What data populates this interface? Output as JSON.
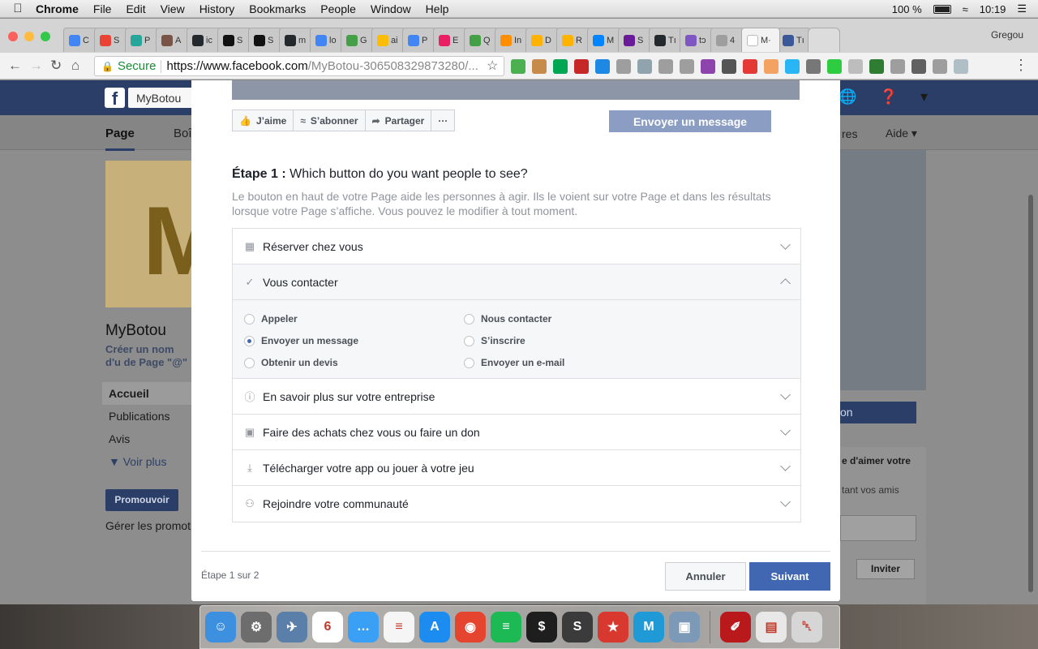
{
  "mac_menu": {
    "app": "Chrome",
    "items": [
      "File",
      "Edit",
      "View",
      "History",
      "Bookmarks",
      "People",
      "Window",
      "Help"
    ],
    "battery": "100 %",
    "time": "10:19"
  },
  "browser": {
    "profile": "Gregou",
    "tabs": [
      {
        "label": "C",
        "color": "#4285f4"
      },
      {
        "label": "S",
        "color": "#ea4335"
      },
      {
        "label": "P",
        "color": "#26a69a"
      },
      {
        "label": "A",
        "color": "#795548"
      },
      {
        "label": "ic",
        "color": "#24292e"
      },
      {
        "label": "S",
        "color": "#111111"
      },
      {
        "label": "S",
        "color": "#111111"
      },
      {
        "label": "m",
        "color": "#24292e"
      },
      {
        "label": "lo",
        "color": "#4285f4"
      },
      {
        "label": "G",
        "color": "#43a047"
      },
      {
        "label": "ai",
        "color": "#fbbc05"
      },
      {
        "label": "P",
        "color": "#4285f4"
      },
      {
        "label": "E",
        "color": "#e91e63"
      },
      {
        "label": "Q",
        "color": "#43a047"
      },
      {
        "label": "In",
        "color": "#ff8f00"
      },
      {
        "label": "D",
        "color": "#ffb300"
      },
      {
        "label": "R",
        "color": "#ffb300"
      },
      {
        "label": "M",
        "color": "#0084ff"
      },
      {
        "label": "S",
        "color": "#6a1b9a"
      },
      {
        "label": "Tı",
        "color": "#24292e"
      },
      {
        "label": "tɔ",
        "color": "#7e57c2"
      },
      {
        "label": "4",
        "color": "#9e9e9e"
      },
      {
        "label": "M·",
        "color": "#ffffff",
        "active": true
      },
      {
        "label": "Tı",
        "color": "#3b5998"
      }
    ],
    "secure_label": "Secure",
    "url_host": "https://www.facebook.com",
    "url_rest": "/MyBotou-306508329873280/...",
    "extensions": [
      "#4caf50",
      "#c68a4b",
      "#00a651",
      "#c62828",
      "#1e88e5",
      "#9e9e9e",
      "#90a4ae",
      "#9e9e9e",
      "#9e9e9e",
      "#8e44ad",
      "#555555",
      "#e53935",
      "#f4a261",
      "#29b6f6",
      "#777777",
      "#2ecc40",
      "#bdbdbd",
      "#2e7d32",
      "#9e9e9e",
      "#616161",
      "#9e9e9e",
      "#b0bec5"
    ]
  },
  "fb": {
    "search_value": "MyBotou",
    "tab_page": "Page",
    "tab_boite": "Boî",
    "tab_res": "res",
    "tab_aide": "Aide ▾",
    "cover_letter": "M",
    "page_name": "MyBotou",
    "page_handle": "Créer un nom d'u de Page \"@\"",
    "nav_items": [
      "Accueil",
      "Publications",
      "Avis"
    ],
    "nav_more": "▼  Voir plus",
    "promote": "Promouvoir",
    "manage": "Gérer les promoti",
    "right_button": "on",
    "right_card_title": "e d'aimer votre",
    "right_card_sub": "tant vos amis",
    "right_card_invite": "Inviter"
  },
  "modal": {
    "preview_actions": [
      {
        "icon": "👍",
        "label": "J’aime"
      },
      {
        "icon": "≈",
        "label": "S’abonner"
      },
      {
        "icon": "➦",
        "label": "Partager"
      },
      {
        "icon": "",
        "label": "···"
      }
    ],
    "preview_cta": "Envoyer un message",
    "step_label": "Étape 1 :",
    "step_question": " Which button do you want people to see?",
    "step_description": "Le bouton en haut de votre Page aide les personnes à agir. Ils le voient sur votre Page et dans les résultats lorsque votre Page s’affiche. Vous pouvez le modifier à tout moment.",
    "categories": [
      {
        "label": "Réserver chez vous",
        "icon": "calendar-icon",
        "glyph": "▦"
      },
      {
        "label": "Vous contacter",
        "icon": "checkmark-icon",
        "glyph": "✓",
        "open": true
      },
      {
        "label": "En savoir plus sur votre entreprise",
        "icon": "info-icon",
        "glyph": "ⓘ"
      },
      {
        "label": "Faire des achats chez vous ou faire un don",
        "icon": "shopping-bag-icon",
        "glyph": "▣"
      },
      {
        "label": "Télécharger votre app ou jouer à votre jeu",
        "icon": "download-icon",
        "glyph": "⤓"
      },
      {
        "label": "Rejoindre votre communauté",
        "icon": "group-icon",
        "glyph": "⚇"
      }
    ],
    "contact_options": [
      {
        "label": "Appeler",
        "checked": false
      },
      {
        "label": "Nous contacter",
        "checked": false
      },
      {
        "label": "Envoyer un message",
        "checked": true
      },
      {
        "label": "S’inscrire",
        "checked": false
      },
      {
        "label": "Obtenir un devis",
        "checked": false
      },
      {
        "label": "Envoyer un e-mail",
        "checked": false
      }
    ],
    "step_count": "Étape 1 sur 2",
    "cancel": "Annuler",
    "next": "Suivant"
  },
  "dock": [
    {
      "name": "finder-icon",
      "color": "#3d8fe0",
      "glyph": "☺"
    },
    {
      "name": "system-preferences-icon",
      "color": "#6d6d6d",
      "glyph": "⚙"
    },
    {
      "name": "preview-icon",
      "color": "#5a7fa8",
      "glyph": "✈"
    },
    {
      "name": "calendar-icon",
      "color": "#ffffff",
      "glyph": "6"
    },
    {
      "name": "messages-icon",
      "color": "#3aa0f5",
      "glyph": "…"
    },
    {
      "name": "reminders-icon",
      "color": "#f5f5f5",
      "glyph": "≡"
    },
    {
      "name": "app-store-icon",
      "color": "#1c8cf1",
      "glyph": "A"
    },
    {
      "name": "chrome-icon",
      "color": "#e5452f",
      "glyph": "◉"
    },
    {
      "name": "spotify-icon",
      "color": "#1db954",
      "glyph": "≡"
    },
    {
      "name": "terminal-icon",
      "color": "#1e1e1e",
      "glyph": "$"
    },
    {
      "name": "sublime-text-icon",
      "color": "#3b3b3b",
      "glyph": "S"
    },
    {
      "name": "wunderlist-icon",
      "color": "#d9382f",
      "glyph": "★"
    },
    {
      "name": "markdown-icon",
      "color": "#1f9ad6",
      "glyph": "M"
    },
    {
      "name": "image-capture-icon",
      "color": "#7c9ab8",
      "glyph": "▣"
    },
    {
      "name": "pdf-icon",
      "color": "#b9191b",
      "glyph": "✐"
    },
    {
      "name": "documents-icon",
      "color": "#e8e8e8",
      "glyph": "▤"
    },
    {
      "name": "trash-icon",
      "color": "#d6d6d6",
      "glyph": "␡"
    }
  ]
}
